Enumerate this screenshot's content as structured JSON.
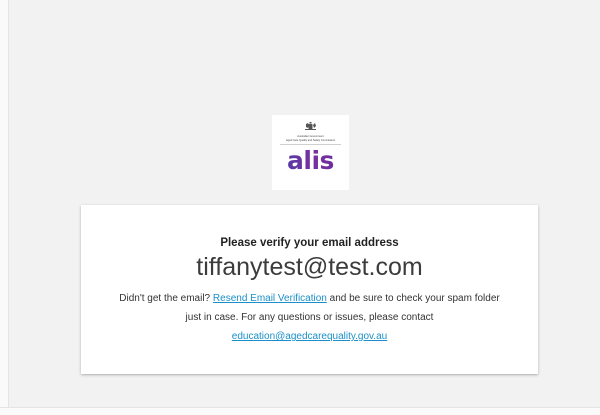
{
  "logo": {
    "gov_line_1": "Australian Government",
    "gov_line_2": "Aged Care Quality and Safety Commission",
    "brand": "alis"
  },
  "verify": {
    "heading": "Please verify your email address",
    "email": "tiffanytest@test.com",
    "text_1": "Didn't get the email? ",
    "resend_link": "Resend Email Verification",
    "text_2": " and be sure to check your spam folder just in case. For any questions or issues, please contact ",
    "contact_email": "education@agedcarequality.gov.au"
  },
  "colors": {
    "background": "#f2f2f2",
    "card": "#ffffff",
    "link": "#1a8fc9",
    "brand_gradient_start": "#4a3fa6",
    "brand_gradient_end": "#7a2fa0"
  }
}
